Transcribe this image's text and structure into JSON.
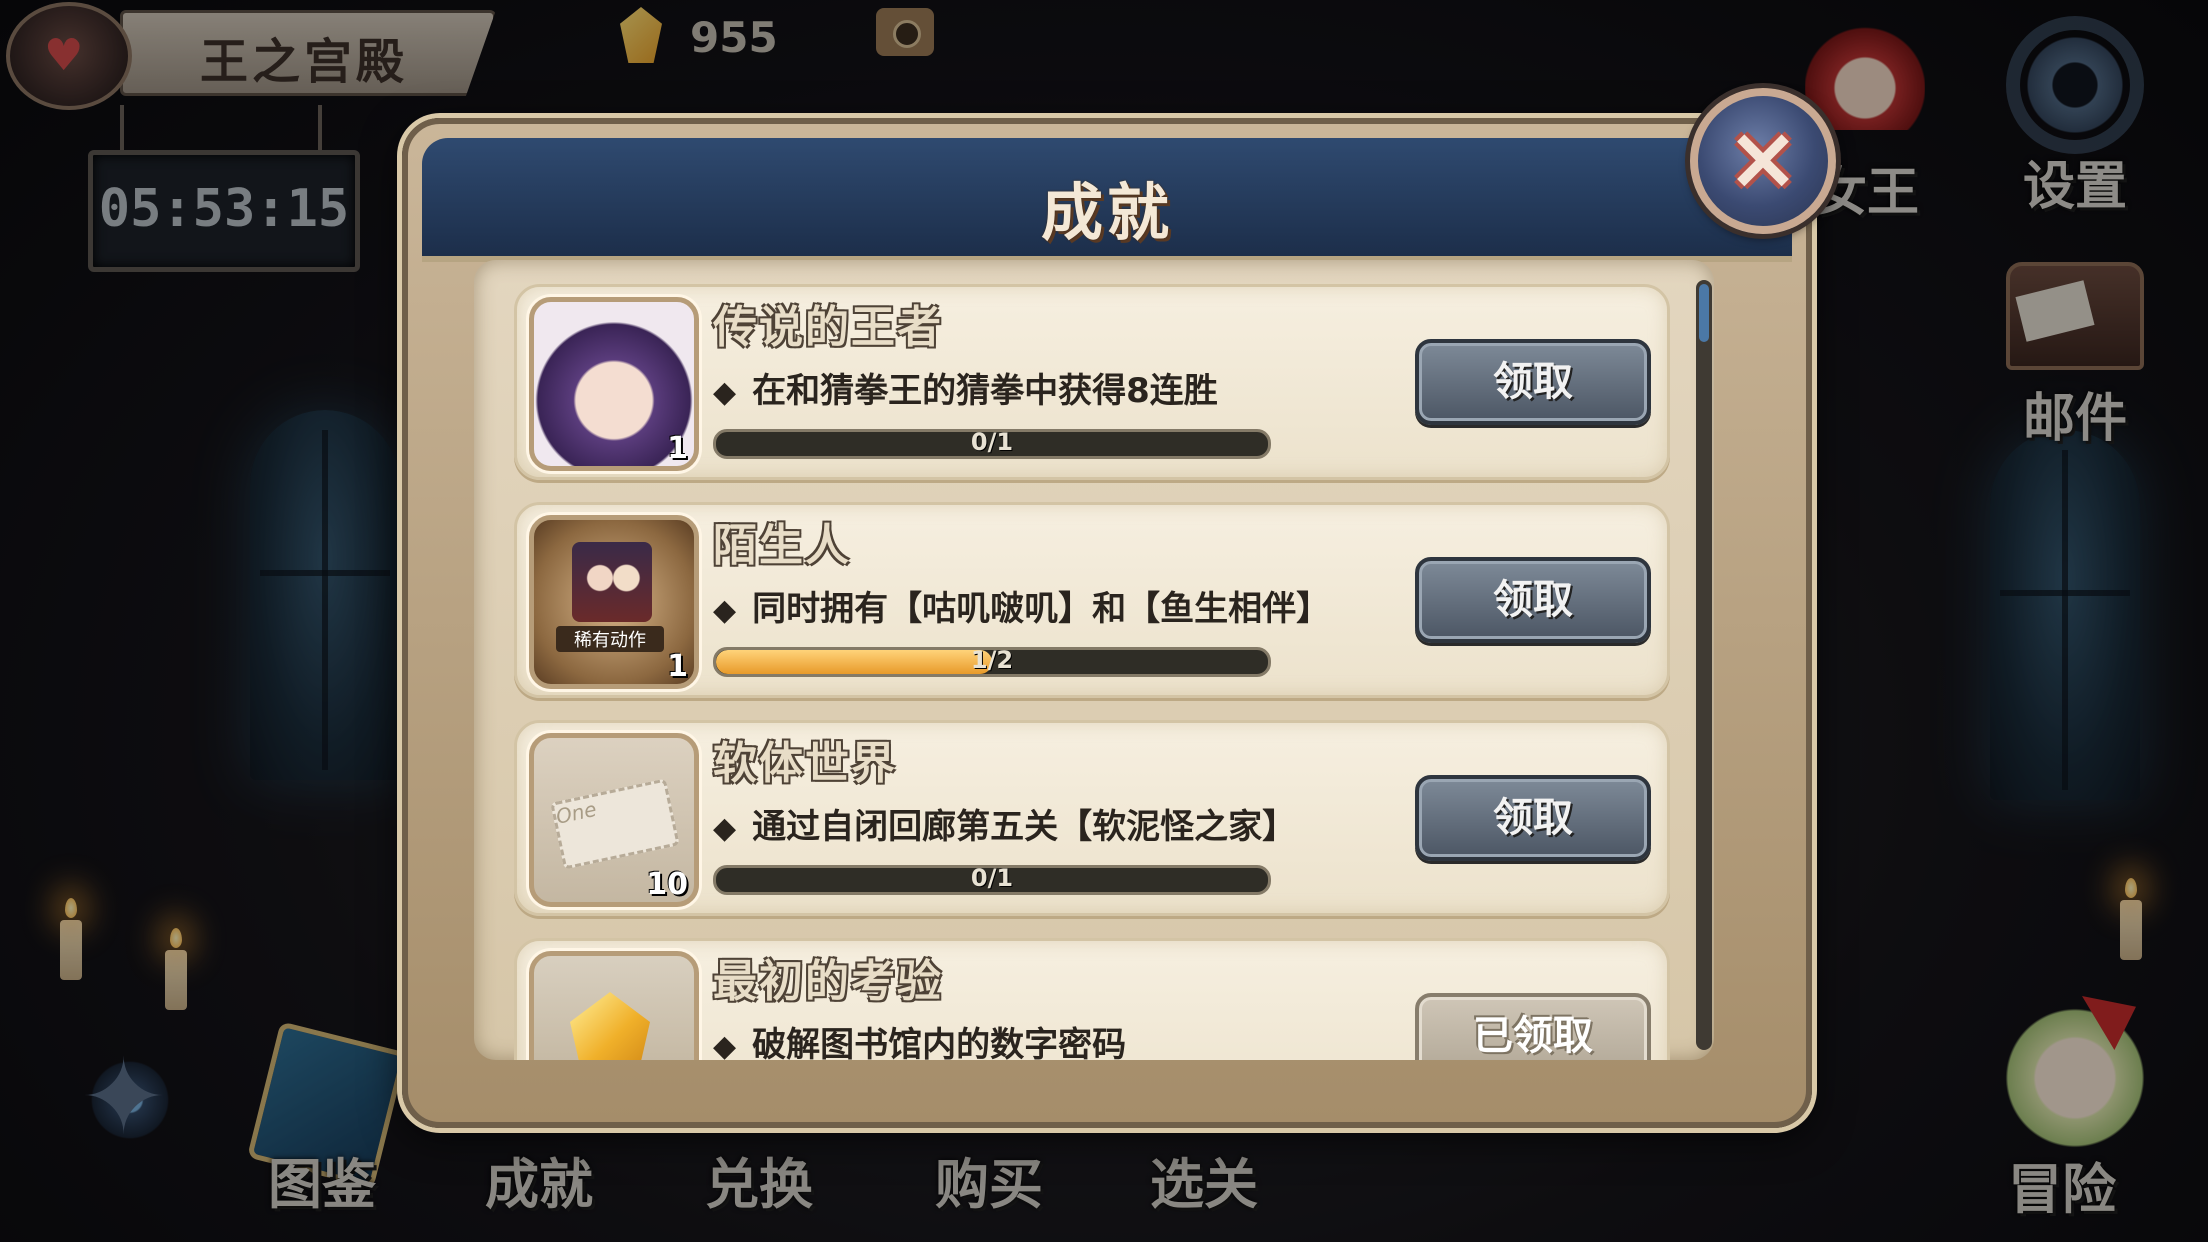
{
  "header": {
    "location_title": "王之宫殿",
    "timer": "05:53:15",
    "gem_count": "955"
  },
  "right_menu": {
    "queen_label": "女王",
    "settings_label": "设置",
    "mail_label": "邮件",
    "adventure_label": "冒险"
  },
  "bottom_nav": {
    "items": [
      "图鉴",
      "成就",
      "兑换",
      "购买",
      "选关"
    ]
  },
  "modal": {
    "title": "成就",
    "close_icon": "×",
    "achievements": [
      {
        "title": "传说的王者",
        "desc": "在和猜拳王的猜拳中获得8连胜",
        "progress_text": "0/1",
        "progress": 0,
        "count": "1",
        "icon": "girl-portrait-icon",
        "button": "领取",
        "claimed": false
      },
      {
        "title": "陌生人",
        "desc": "同时拥有【咕叽啵叽】和【鱼生相伴】",
        "progress_text": "1/2",
        "progress": 0.5,
        "count": "1",
        "icon": "rare-action-card-icon",
        "icon_label": "稀有动作",
        "button": "领取",
        "claimed": false
      },
      {
        "title": "软体世界",
        "desc": "通过自闭回廊第五关【软泥怪之家】",
        "progress_text": "0/1",
        "progress": 0,
        "count": "10",
        "icon": "ticket-icon",
        "icon_label": "One",
        "button": "领取",
        "claimed": false
      },
      {
        "title": "最初的考验",
        "desc": "破解图书馆内的数字密码",
        "icon": "gem-icon",
        "button": "已领取",
        "claimed": true
      }
    ]
  }
}
